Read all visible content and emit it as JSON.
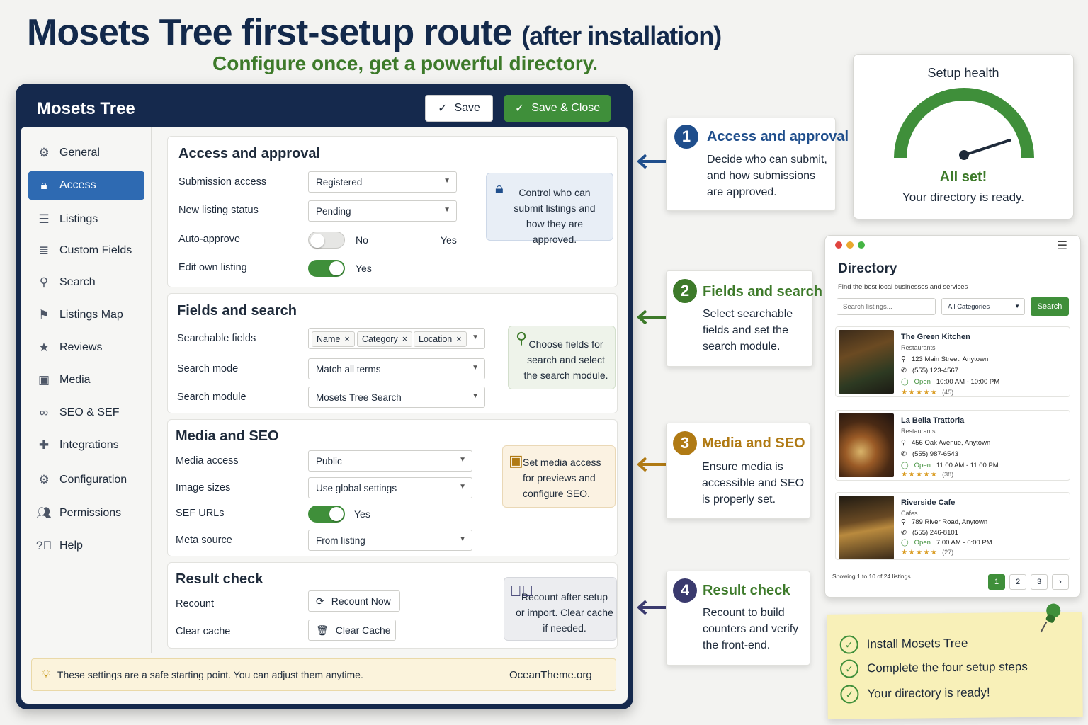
{
  "header": {
    "title": "Mosets Tree first-setup route",
    "title_suffix": "(after installation)",
    "tagline": "Configure once, get a powerful directory."
  },
  "window": {
    "title": "Mosets Tree",
    "save_label": "Save",
    "save_close_label": "Save & Close"
  },
  "sidebar": {
    "items": [
      {
        "label": "General",
        "icon": "gear-icon"
      },
      {
        "label": "Access",
        "icon": "lock-icon",
        "active": true
      },
      {
        "label": "Listings",
        "icon": "list-icon"
      },
      {
        "label": "Custom Fields",
        "icon": "database-icon"
      },
      {
        "label": "Search",
        "icon": "search-icon"
      },
      {
        "label": "Listings Map",
        "icon": "map-pin-icon"
      },
      {
        "label": "Reviews",
        "icon": "star-icon"
      },
      {
        "label": "Media",
        "icon": "image-icon"
      },
      {
        "label": "SEO & SEF",
        "icon": "link-icon"
      },
      {
        "label": "Integrations",
        "icon": "puzzle-icon"
      },
      {
        "label": "Configuration",
        "icon": "gear-icon"
      },
      {
        "label": "Permissions",
        "icon": "users-icon"
      },
      {
        "label": "Help",
        "icon": "help-icon"
      }
    ]
  },
  "access": {
    "title": "Access and approval",
    "submission_label": "Submission access",
    "submission_value": "Registered",
    "status_label": "New listing status",
    "status_value": "Pending",
    "auto_label": "Auto-approve",
    "auto_value": "No",
    "auto_alt": "Yes",
    "edit_label": "Edit own listing",
    "edit_value": "Yes",
    "hint": "Control who can submit listings and how they are approved."
  },
  "fields": {
    "title": "Fields and search",
    "searchable_label": "Searchable fields",
    "chips": [
      "Name",
      "Category",
      "Location"
    ],
    "mode_label": "Search mode",
    "mode_value": "Match all terms",
    "module_label": "Search module",
    "module_value": "Mosets Tree Search",
    "hint": "Choose fields for search and select the search module."
  },
  "media": {
    "title": "Media and SEO",
    "access_label": "Media access",
    "access_value": "Public",
    "sizes_label": "Image sizes",
    "sizes_value": "Use global settings",
    "sef_label": "SEF URLs",
    "sef_value": "Yes",
    "meta_label": "Meta source",
    "meta_value": "From listing",
    "hint": "Set media access for previews and configure SEO."
  },
  "result": {
    "title": "Result check",
    "recount_label": "Recount",
    "recount_btn": "Recount Now",
    "cache_label": "Clear cache",
    "cache_btn": "Clear Cache",
    "hint": "Recount after setup or import. Clear cache if needed."
  },
  "footer": {
    "text": "These settings are a safe starting point. You can adjust them anytime.",
    "brand": "OceanTheme.org"
  },
  "steps": [
    {
      "num": "1",
      "title": "Access and approval",
      "desc": "Decide who can submit, and how submissions are approved.",
      "color": "#1f4e8c"
    },
    {
      "num": "2",
      "title": "Fields and search",
      "desc": "Select searchable fields and set the search module.",
      "color": "#3d7a2a"
    },
    {
      "num": "3",
      "title": "Media and SEO",
      "desc": "Ensure media is accessible and SEO is properly set.",
      "color": "#b07a14"
    },
    {
      "num": "4",
      "title": "Result check",
      "desc": "Recount to build counters and verify the front-end.",
      "color": "#3a3a6e"
    }
  ],
  "health": {
    "title": "Setup health",
    "status": "All set!",
    "message": "Your directory is ready.",
    "level": 0.9
  },
  "directory": {
    "title": "Directory",
    "subtitle": "Find the best local businesses and services",
    "search_placeholder": "Search listings...",
    "category_value": "All Categories",
    "search_btn": "Search",
    "listings": [
      {
        "name": "The Green Kitchen",
        "category": "Restaurants",
        "address": "123 Main Street, Anytown",
        "phone": "(555) 123-4567",
        "open": "Open",
        "hours": "10:00 AM - 10:00 PM",
        "stars": "★★★★★",
        "count": "(45)"
      },
      {
        "name": "La Bella Trattoria",
        "category": "Restaurants",
        "address": "456 Oak Avenue, Anytown",
        "phone": "(555) 987-6543",
        "open": "Open",
        "hours": "11:00 AM - 11:00 PM",
        "stars": "★★★★★",
        "count": "(38)"
      },
      {
        "name": "Riverside Cafe",
        "category": "Cafes",
        "address": "789 River Road, Anytown",
        "phone": "(555) 246-8101",
        "open": "Open",
        "hours": "7:00 AM - 6:00 PM",
        "stars": "★★★★★",
        "count": "(27)"
      }
    ],
    "showing": "Showing 1 to 10 of 24 listings",
    "pages": [
      "1",
      "2",
      "3",
      "›"
    ]
  },
  "checklist": {
    "items": [
      "Install Mosets Tree",
      "Complete the four setup steps",
      "Your directory is ready!"
    ]
  }
}
